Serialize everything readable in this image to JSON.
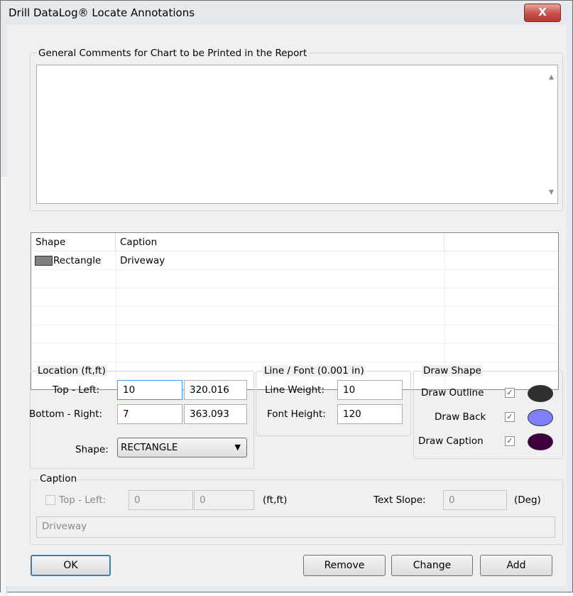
{
  "window": {
    "title": "Drill DataLog® Locate Annotations",
    "close_label": "X"
  },
  "comments": {
    "legend": "General Comments for Chart to be Printed in the Report",
    "value": ""
  },
  "list": {
    "columns": [
      "Shape",
      "Caption"
    ],
    "rows": [
      {
        "shape": "Rectangle",
        "caption": "Driveway",
        "swatch_color": "#808080"
      }
    ]
  },
  "location": {
    "legend": "Location (ft,ft)",
    "top_left_label": "Top - Left:",
    "top_left_x": "10",
    "top_left_y": "320.016",
    "bottom_right_label": "Bottom - Right:",
    "bottom_right_x": "7",
    "bottom_right_y": "363.093",
    "shape_label": "Shape:",
    "shape_value": "RECTANGLE"
  },
  "linefont": {
    "legend": "Line / Font (0.001 in)",
    "line_weight_label": "Line Weight:",
    "line_weight": "10",
    "font_height_label": "Font Height:",
    "font_height": "120"
  },
  "drawshape": {
    "legend": "Draw Shape",
    "items": [
      {
        "label": "Draw Outline",
        "checked": true,
        "color": "#303030"
      },
      {
        "label": "Draw Back",
        "checked": true,
        "color": "#8080ff"
      },
      {
        "label": "Draw Caption",
        "checked": true,
        "color": "#400040"
      }
    ]
  },
  "caption": {
    "legend": "Caption",
    "top_left_label": "Top - Left:",
    "x": "0",
    "y": "0",
    "units": "(ft,ft)",
    "slope_label": "Text Slope:",
    "slope": "0",
    "slope_units": "(Deg)",
    "text": "Driveway"
  },
  "buttons": {
    "ok": "OK",
    "remove": "Remove",
    "change": "Change",
    "add": "Add"
  }
}
